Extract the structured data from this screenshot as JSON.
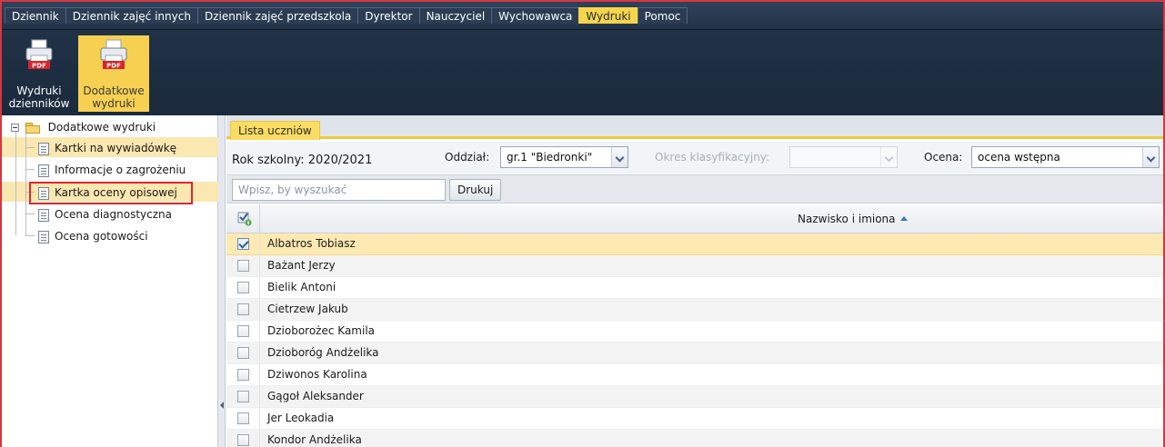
{
  "menu": {
    "items": [
      {
        "label": "Dziennik"
      },
      {
        "label": "Dziennik zajęć innych"
      },
      {
        "label": "Dziennik zajęć przedszkola"
      },
      {
        "label": "Dyrektor"
      },
      {
        "label": "Nauczyciel"
      },
      {
        "label": "Wychowawca"
      },
      {
        "label": "Wydruki",
        "active": true
      },
      {
        "label": "Pomoc"
      }
    ]
  },
  "toolbar": {
    "buttons": [
      {
        "label_line1": "Wydruki",
        "label_line2": "dzienników",
        "icon": "pdf-printer-icon",
        "icon_badge": "PDF"
      },
      {
        "label_line1": "Dodatkowe",
        "label_line2": "wydruki",
        "icon": "pdf-printer-icon",
        "icon_badge": "PDF",
        "active": true
      }
    ]
  },
  "tree": {
    "root_label": "Dodatkowe wydruki",
    "items": [
      {
        "label": "Kartki na wywiadówkę"
      },
      {
        "label": "Informacje o zagrożeniu"
      },
      {
        "label": "Kartka oceny opisowej",
        "selected": true
      },
      {
        "label": "Ocena diagnostyczna"
      },
      {
        "label": "Ocena gotowości"
      }
    ]
  },
  "main": {
    "tab_label": "Lista uczniów",
    "school_year": "Rok szkolny: 2020/2021",
    "oddzial_label": "Oddział:",
    "oddzial_value": "gr.1 \"Biedronki\"",
    "okres_label": "Okres klasyfikacyjny:",
    "okres_value": "",
    "ocena_label": "Ocena:",
    "ocena_value": "ocena wstępna",
    "search_placeholder": "Wpisz, by wyszukać",
    "print_label": "Drukuj",
    "column_header": "Nazwisko i imiona",
    "students": [
      {
        "name": "Albatros Tobiasz",
        "checked": true
      },
      {
        "name": "Bażant Jerzy",
        "checked": false
      },
      {
        "name": "Bielik Antoni",
        "checked": false
      },
      {
        "name": "Cietrzew Jakub",
        "checked": false
      },
      {
        "name": "Dzioborożec Kamila",
        "checked": false
      },
      {
        "name": "Dzioboróg Andżelika",
        "checked": false
      },
      {
        "name": "Dziwonos Karolina",
        "checked": false
      },
      {
        "name": "Gągoł Aleksander",
        "checked": false
      },
      {
        "name": "Jer Leokadia",
        "checked": false
      },
      {
        "name": "Kondor Andżelika",
        "checked": false
      }
    ]
  },
  "colors": {
    "accent": "#f8d54a",
    "menubar": "#2b3c53",
    "selection_row": "#fde9b2",
    "highlight_border": "#e3242b"
  }
}
